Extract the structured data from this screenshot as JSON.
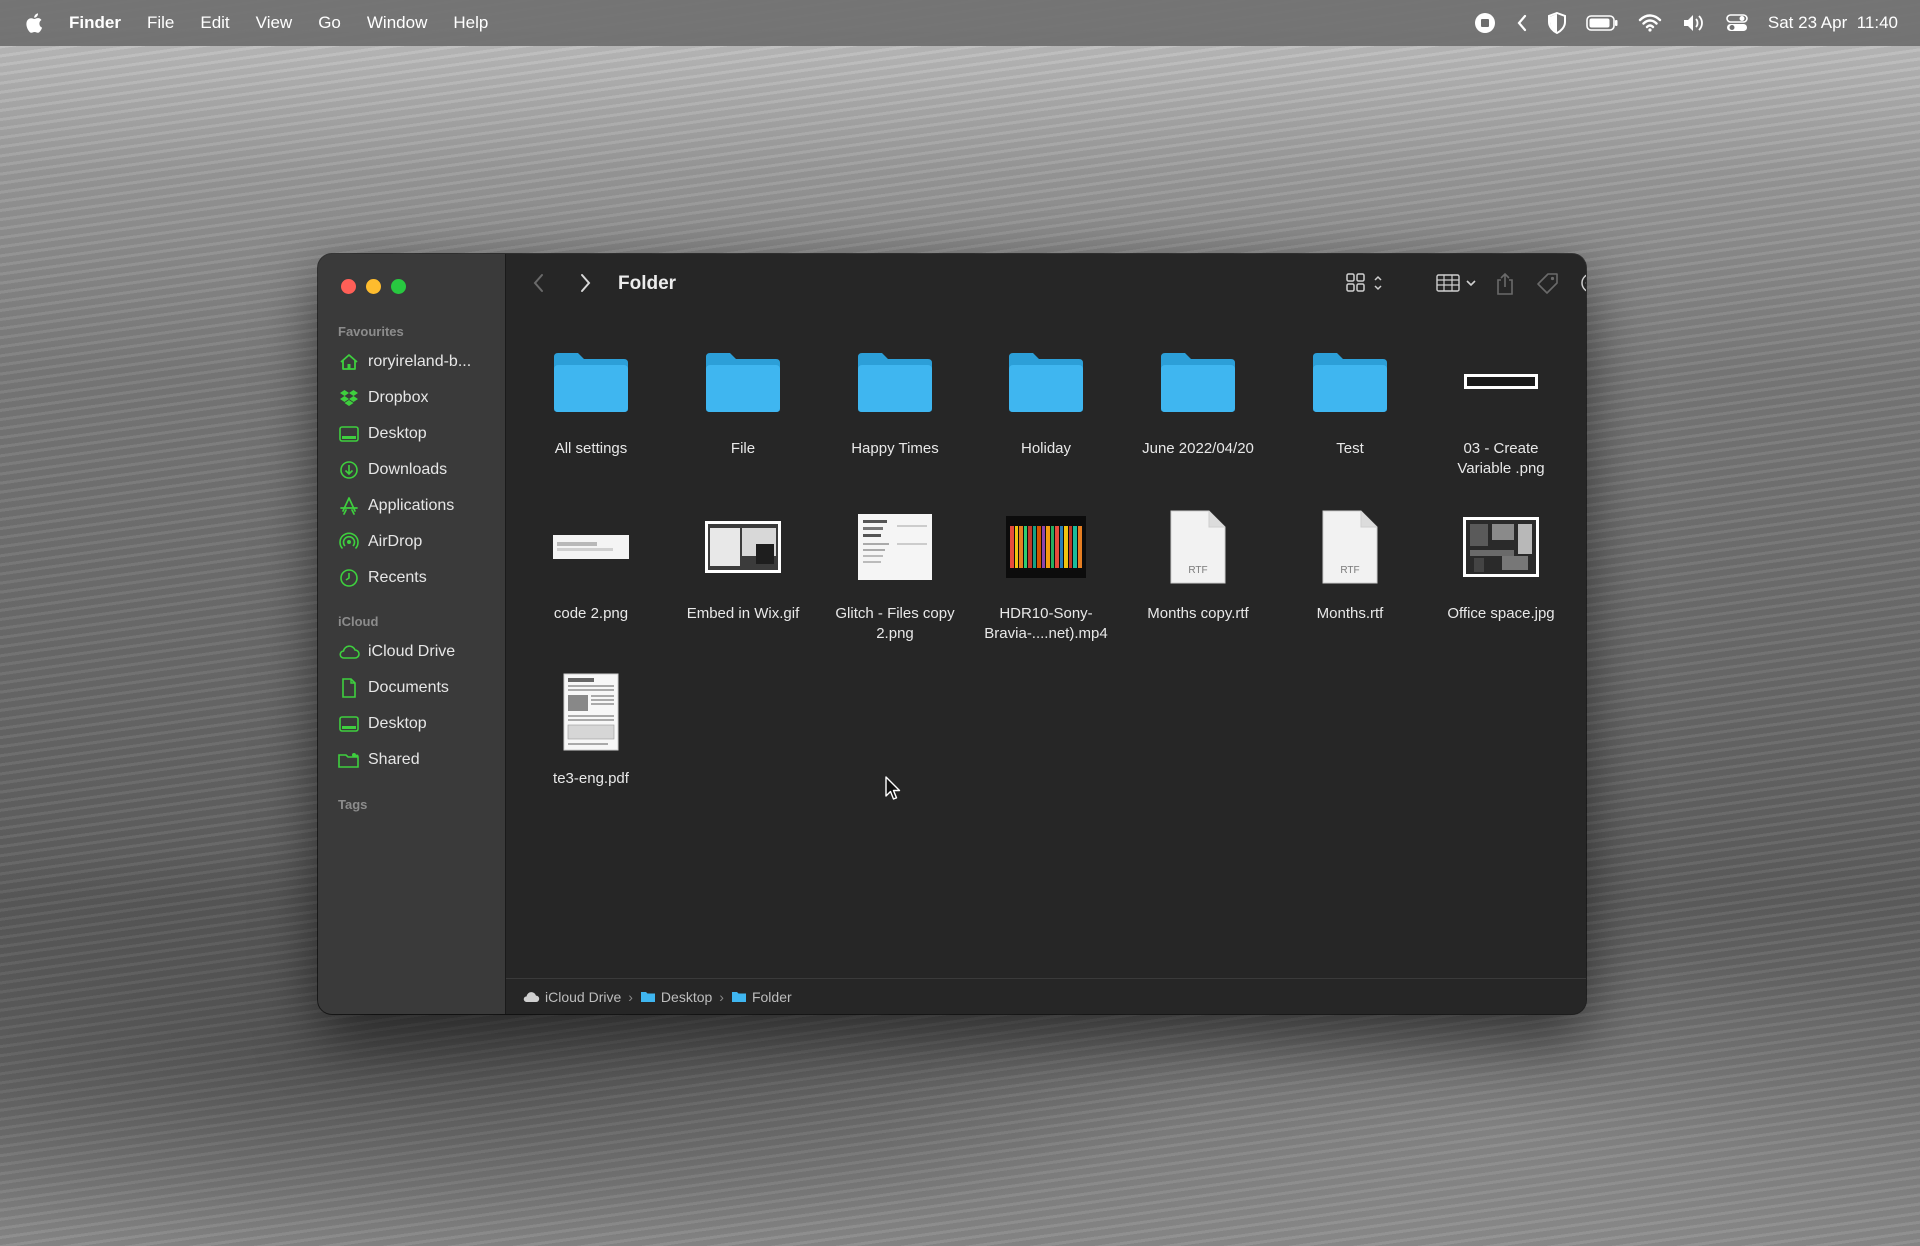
{
  "menubar": {
    "app_name": "Finder",
    "menus": [
      "File",
      "Edit",
      "View",
      "Go",
      "Window",
      "Help"
    ],
    "clock": "Sat 23 Apr  11:40",
    "status_icons": [
      "screen-record-icon",
      "chevron-left-icon",
      "shield-icon",
      "battery-icon",
      "wifi-icon",
      "volume-icon",
      "control-center-icon"
    ]
  },
  "window": {
    "title": "Folder",
    "sidebar": {
      "favourites_heading": "Favourites",
      "favourites": [
        {
          "label": "roryireland-b...",
          "icon": "home-icon"
        },
        {
          "label": "Dropbox",
          "icon": "dropbox-icon"
        },
        {
          "label": "Desktop",
          "icon": "desktop-icon"
        },
        {
          "label": "Downloads",
          "icon": "downloads-icon"
        },
        {
          "label": "Applications",
          "icon": "applications-icon"
        },
        {
          "label": "AirDrop",
          "icon": "airdrop-icon"
        },
        {
          "label": "Recents",
          "icon": "clock-icon"
        }
      ],
      "icloud_heading": "iCloud",
      "icloud": [
        {
          "label": "iCloud Drive",
          "icon": "cloud-icon"
        },
        {
          "label": "Documents",
          "icon": "document-icon"
        },
        {
          "label": "Desktop",
          "icon": "desktop-icon"
        },
        {
          "label": "Shared",
          "icon": "shared-folder-icon"
        }
      ],
      "tags_heading": "Tags"
    },
    "files": [
      {
        "name": "All settings",
        "kind": "folder"
      },
      {
        "name": "File",
        "kind": "folder"
      },
      {
        "name": "Happy Times",
        "kind": "folder"
      },
      {
        "name": "Holiday",
        "kind": "folder"
      },
      {
        "name": "June 2022/04/20",
        "kind": "folder"
      },
      {
        "name": "Test",
        "kind": "folder"
      },
      {
        "name": "03 - Create\nVariable .png",
        "kind": "image-bar"
      },
      {
        "name": "code 2.png",
        "kind": "image-wide"
      },
      {
        "name": "Embed in Wix.gif",
        "kind": "image-screenshot"
      },
      {
        "name": "Glitch - Files copy\n2.png",
        "kind": "image-menu"
      },
      {
        "name": "HDR10-Sony-\nBravia-....net).mp4",
        "kind": "video"
      },
      {
        "name": "Months copy.rtf",
        "kind": "rtf"
      },
      {
        "name": "Months.rtf",
        "kind": "rtf"
      },
      {
        "name": "Office space.jpg",
        "kind": "photo"
      },
      {
        "name": "te3-eng.pdf",
        "kind": "pdf"
      }
    ],
    "rtf_badge": "RTF",
    "path": [
      "iCloud Drive",
      "Desktop",
      "Folder"
    ],
    "path_separator": "›"
  },
  "colors": {
    "folder_blue": "#3fb6f0",
    "sidebar_icon_green": "#3ecf3e",
    "close": "#ff5f57",
    "minimize": "#febc2e",
    "zoom": "#28c840"
  }
}
